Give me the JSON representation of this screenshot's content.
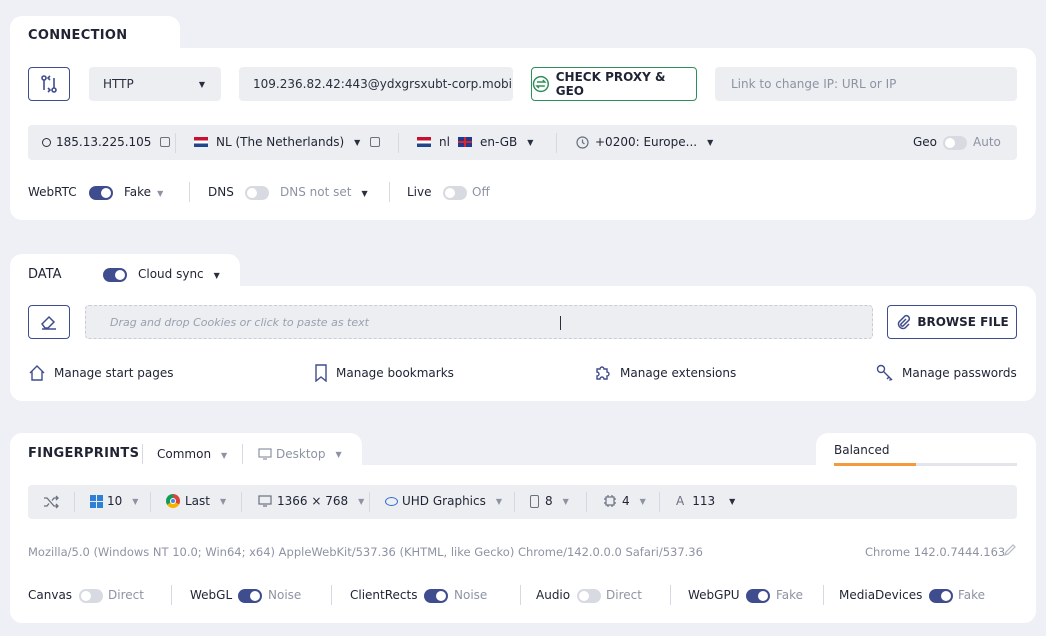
{
  "connection": {
    "title": "CONNECTION",
    "proxy_type": "HTTP",
    "proxy_string": "109.236.82.42:443@ydxgrsxubt-corp.mobi",
    "check_button": "CHECK PROXY & GEO",
    "change_ip_placeholder": "Link to change IP: URL or IP",
    "ip": "185.13.225.105",
    "country": "NL (The Netherlands)",
    "lang_code": "nl",
    "locale": "en-GB",
    "timezone": "+0200: Europe...",
    "geo_label": "Geo",
    "geo_value": "Auto",
    "webrtc_label": "WebRTC",
    "webrtc_value": "Fake",
    "dns_label": "DNS",
    "dns_value": "DNS not set",
    "live_label": "Live",
    "live_value": "Off"
  },
  "data": {
    "title": "DATA",
    "cloud_sync_label": "Cloud sync",
    "dropzone_text": "Drag and drop Cookies or click to paste as text",
    "browse_button": "BROWSE FILE",
    "links": {
      "start_pages": "Manage start pages",
      "bookmarks": "Manage bookmarks",
      "extensions": "Manage extensions",
      "passwords": "Manage passwords"
    }
  },
  "fingerprints": {
    "title": "FINGERPRINTS",
    "mode": "Common",
    "platform": "Desktop",
    "preset": "Balanced",
    "os_version": "10",
    "browser_version": "Last",
    "resolution": "1366 × 768",
    "gpu": "UHD Graphics",
    "memory": "8",
    "cpu": "4",
    "fonts_count": "113",
    "user_agent": "Mozilla/5.0 (Windows NT 10.0; Win64; x64) AppleWebKit/537.36 (KHTML, like Gecko) Chrome/142.0.0.0 Safari/537.36",
    "browser_build": "Chrome 142.0.7444.163",
    "toggles": [
      {
        "label": "Canvas",
        "value": "Direct",
        "on": false
      },
      {
        "label": "WebGL",
        "value": "Noise",
        "on": true
      },
      {
        "label": "ClientRects",
        "value": "Noise",
        "on": true
      },
      {
        "label": "Audio",
        "value": "Direct",
        "on": false
      },
      {
        "label": "WebGPU",
        "value": "Fake",
        "on": true
      },
      {
        "label": "MediaDevices",
        "value": "Fake",
        "on": true
      }
    ]
  },
  "colors": {
    "accent": "#3f4d8f",
    "check_button_border": "#2f8f5a",
    "preset_underline": "#f39a3c"
  }
}
